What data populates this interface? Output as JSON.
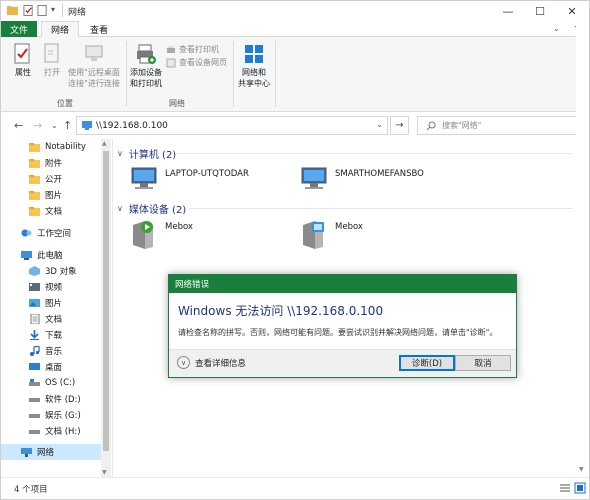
{
  "window": {
    "title": "网络",
    "minimize": "—",
    "maximize": "☐",
    "close": "✕",
    "help": "?"
  },
  "ribbon": {
    "tabs": [
      "文件",
      "网络",
      "查看"
    ],
    "buttons": {
      "properties": "属性",
      "open": "打开",
      "remote_desktop_line1": "使用\"远程桌面",
      "remote_desktop_line2": "连接\"进行连接",
      "add_devices_line1": "添加设备",
      "add_devices_line2": "和打印机",
      "view_printers": "查看打印机",
      "view_device_page": "查看设备网页",
      "network_center_line1": "网络和",
      "network_center_line2": "共享中心"
    },
    "groups": [
      "位置",
      "网络"
    ]
  },
  "address": {
    "path": "\\\\192.168.0.100",
    "search_placeholder": "搜索\"网络\""
  },
  "nav": {
    "items": [
      {
        "label": "Notability",
        "icon": "folder-icon"
      },
      {
        "label": "附件",
        "icon": "folder-icon"
      },
      {
        "label": "公开",
        "icon": "folder-icon"
      },
      {
        "label": "图片",
        "icon": "folder-icon"
      },
      {
        "label": "文档",
        "icon": "folder-icon"
      },
      {
        "label": "工作空间",
        "icon": "workspace-icon"
      },
      {
        "label": "此电脑",
        "icon": "pc-icon"
      },
      {
        "label": "3D 对象",
        "icon": "3d-objects-icon"
      },
      {
        "label": "视频",
        "icon": "videos-icon"
      },
      {
        "label": "图片",
        "icon": "pictures-icon"
      },
      {
        "label": "文档",
        "icon": "documents-icon"
      },
      {
        "label": "下载",
        "icon": "downloads-icon"
      },
      {
        "label": "音乐",
        "icon": "music-icon"
      },
      {
        "label": "桌面",
        "icon": "desktop-icon"
      },
      {
        "label": "OS (C:)",
        "icon": "drive-c-icon"
      },
      {
        "label": "软件 (D:)",
        "icon": "drive-icon"
      },
      {
        "label": "娱乐 (G:)",
        "icon": "drive-icon"
      },
      {
        "label": "文档 (H:)",
        "icon": "drive-icon"
      },
      {
        "label": "网络",
        "icon": "network-icon"
      }
    ]
  },
  "content": {
    "groups": [
      {
        "title": "计算机 (2)",
        "items": [
          "LAPTOP-UTQTODAR",
          "SMARTHOMEFANSBO"
        ]
      },
      {
        "title": "媒体设备 (2)",
        "items": [
          "Mebox",
          "Mebox"
        ]
      }
    ]
  },
  "status": {
    "item_count": "4 个项目"
  },
  "dialog": {
    "title": "网络错误",
    "heading": "Windows 无法访问 \\\\192.168.0.100",
    "message": "请检查名称的拼写。否则，网络可能有问题。要尝试识别并解决网络问题，请单击\"诊断\"。",
    "details": "查看详细信息",
    "diagnose": "诊断(D)",
    "cancel": "取消"
  },
  "colors": {
    "accent_green": "#1a7f3c",
    "heading_blue": "#1e3287",
    "selection": "#cce8ff"
  }
}
